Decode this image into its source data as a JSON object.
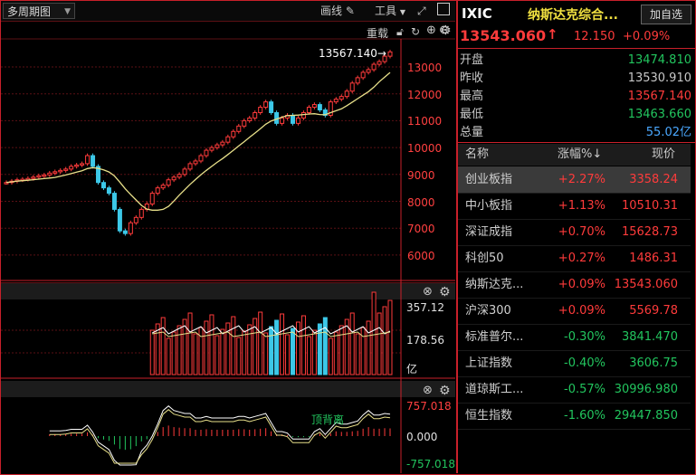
{
  "toolbar": {
    "period_label": "多周期图",
    "draw_label": "画线",
    "tools_label": "工具",
    "redo_label": "重载"
  },
  "main_chart": {
    "high_label": "13567.140→",
    "y_ticks": [
      "13000",
      "12000",
      "11000",
      "10000",
      "9000",
      "8000",
      "7000",
      "6000"
    ]
  },
  "volume_chart": {
    "y_ticks": [
      "357.12",
      "178.56",
      "亿"
    ]
  },
  "macd_chart": {
    "y_ticks": [
      "757.018",
      "0.000",
      "-757.018"
    ],
    "annotation": "顶背离"
  },
  "quote": {
    "symbol": "IXIC",
    "name": "纳斯达克综合...",
    "add_button": "加自选",
    "price": "13543.060",
    "change": "12.150",
    "change_pct": "+0.09%"
  },
  "stats": [
    {
      "label": "开盘",
      "value": "13474.810",
      "color": "green"
    },
    {
      "label": "昨收",
      "value": "13530.910",
      "color": "normal"
    },
    {
      "label": "最高",
      "value": "13567.140",
      "color": "red"
    },
    {
      "label": "最低",
      "value": "13463.660",
      "color": "green"
    },
    {
      "label": "总量",
      "value": "55.02亿",
      "color": "blue"
    }
  ],
  "index_table": {
    "headers": [
      "名称",
      "涨幅%↓",
      "现价"
    ],
    "rows": [
      {
        "name": "创业板指",
        "change": "+2.27%",
        "price": "3358.24",
        "dir": "up"
      },
      {
        "name": "中小板指",
        "change": "+1.13%",
        "price": "10510.31",
        "dir": "up"
      },
      {
        "name": "深证成指",
        "change": "+0.70%",
        "price": "15628.73",
        "dir": "up"
      },
      {
        "name": "科创50",
        "change": "+0.27%",
        "price": "1486.31",
        "dir": "up"
      },
      {
        "name": "纳斯达克...",
        "change": "+0.09%",
        "price": "13543.060",
        "dir": "up"
      },
      {
        "name": "沪深300",
        "change": "+0.09%",
        "price": "5569.78",
        "dir": "up"
      },
      {
        "name": "标准普尔...",
        "change": "-0.30%",
        "price": "3841.470",
        "dir": "down"
      },
      {
        "name": "上证指数",
        "change": "-0.40%",
        "price": "3606.75",
        "dir": "down"
      },
      {
        "name": "道琼斯工...",
        "change": "-0.57%",
        "price": "30996.980",
        "dir": "down"
      },
      {
        "name": "恒生指数",
        "change": "-1.60%",
        "price": "29447.850",
        "dir": "down"
      }
    ]
  },
  "colors": {
    "up": "#ff3b3b",
    "down": "#22c55e",
    "frame": "#c8202a",
    "ma": "#e8e08a",
    "bar_down": "#3cc8e8"
  }
}
